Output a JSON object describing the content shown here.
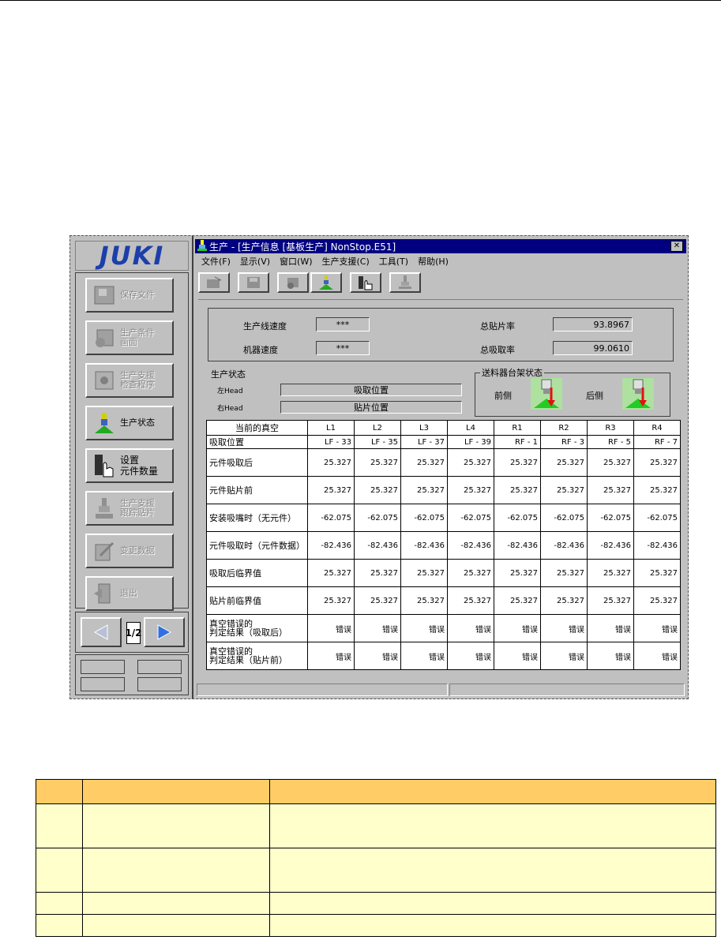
{
  "window": {
    "title": "生产 - [生产信息 [基板生产] NonStop.E51]",
    "close_label": "✕"
  },
  "menu": [
    "文件(F)",
    "显示(V)",
    "窗口(W)",
    "生产支援(C)",
    "工具(T)",
    "帮助(H)"
  ],
  "logo": "JUKI",
  "nav": [
    {
      "label": "保存文件",
      "icon": "save-file-icon",
      "enabled": false
    },
    {
      "label": "生产条件\n画面",
      "icon": "production-conditions-icon",
      "enabled": false
    },
    {
      "label": "生产支援\n检查程序",
      "icon": "check-program-icon",
      "enabled": false
    },
    {
      "label": "生产状态",
      "icon": "production-status-icon",
      "enabled": true
    },
    {
      "label": "设置\n元件数量",
      "icon": "set-quantity-icon",
      "enabled": true
    },
    {
      "label": "生产支援\n跟踪贴片",
      "icon": "tracking-mount-icon",
      "enabled": false
    },
    {
      "label": "变更数据",
      "icon": "change-data-icon",
      "enabled": false
    },
    {
      "label": "退出",
      "icon": "exit-icon",
      "enabled": false
    }
  ],
  "pager": {
    "page": "1/2"
  },
  "speed": {
    "line_speed_label": "生产线速度",
    "line_speed_value": "***",
    "machine_speed_label": "机器速度",
    "machine_speed_value": "***",
    "total_mount_label": "总贴片率",
    "total_mount_value": "93.8967",
    "total_pick_label": "总吸取率",
    "total_pick_value": "99.0610"
  },
  "status": {
    "title": "生产状态",
    "left_head_label": "左Head",
    "left_head_value": "吸取位置",
    "right_head_label": "右Head",
    "right_head_value": "贴片位置"
  },
  "feeder": {
    "title": "送料器台架状态",
    "front": "前侧",
    "rear": "后侧"
  },
  "table": {
    "corner": "当前的真空",
    "columns": [
      "L1",
      "L2",
      "L3",
      "L4",
      "R1",
      "R2",
      "R3",
      "R4"
    ],
    "rows": [
      {
        "label": "吸取位置",
        "values": [
          "LF - 33",
          "LF - 35",
          "LF - 37",
          "LF - 39",
          "RF -  1",
          "RF -  3",
          "RF -  5",
          "RF -  7"
        ]
      },
      {
        "label": "元件吸取后",
        "values": [
          "25.327",
          "25.327",
          "25.327",
          "25.327",
          "25.327",
          "25.327",
          "25.327",
          "25.327"
        ]
      },
      {
        "label": "元件贴片前",
        "values": [
          "25.327",
          "25.327",
          "25.327",
          "25.327",
          "25.327",
          "25.327",
          "25.327",
          "25.327"
        ]
      },
      {
        "label": "安装吸嘴时（无元件）",
        "values": [
          "-62.075",
          "-62.075",
          "-62.075",
          "-62.075",
          "-62.075",
          "-62.075",
          "-62.075",
          "-62.075"
        ]
      },
      {
        "label": "元件吸取时（元件数据）",
        "values": [
          "-82.436",
          "-82.436",
          "-82.436",
          "-82.436",
          "-82.436",
          "-82.436",
          "-82.436",
          "-82.436"
        ]
      },
      {
        "label": "吸取后临界值",
        "values": [
          "25.327",
          "25.327",
          "25.327",
          "25.327",
          "25.327",
          "25.327",
          "25.327",
          "25.327"
        ]
      },
      {
        "label": "贴片前临界值",
        "values": [
          "25.327",
          "25.327",
          "25.327",
          "25.327",
          "25.327",
          "25.327",
          "25.327",
          "25.327"
        ]
      },
      {
        "label": "真空错误的\n判定结果（吸取后）",
        "values": [
          "错误",
          "错误",
          "错误",
          "错误",
          "错误",
          "错误",
          "错误",
          "错误"
        ]
      },
      {
        "label": "真空错误的\n判定结果（贴片前）",
        "values": [
          "错误",
          "错误",
          "错误",
          "错误",
          "错误",
          "错误",
          "错误",
          "错误"
        ]
      }
    ]
  },
  "colors": {
    "title_bar": "#000080",
    "logo": "#1c3faa",
    "header_row": "#ffcc66",
    "body_row": "#ffffcc",
    "arrow": "#e01010",
    "base": "#22cc22"
  }
}
